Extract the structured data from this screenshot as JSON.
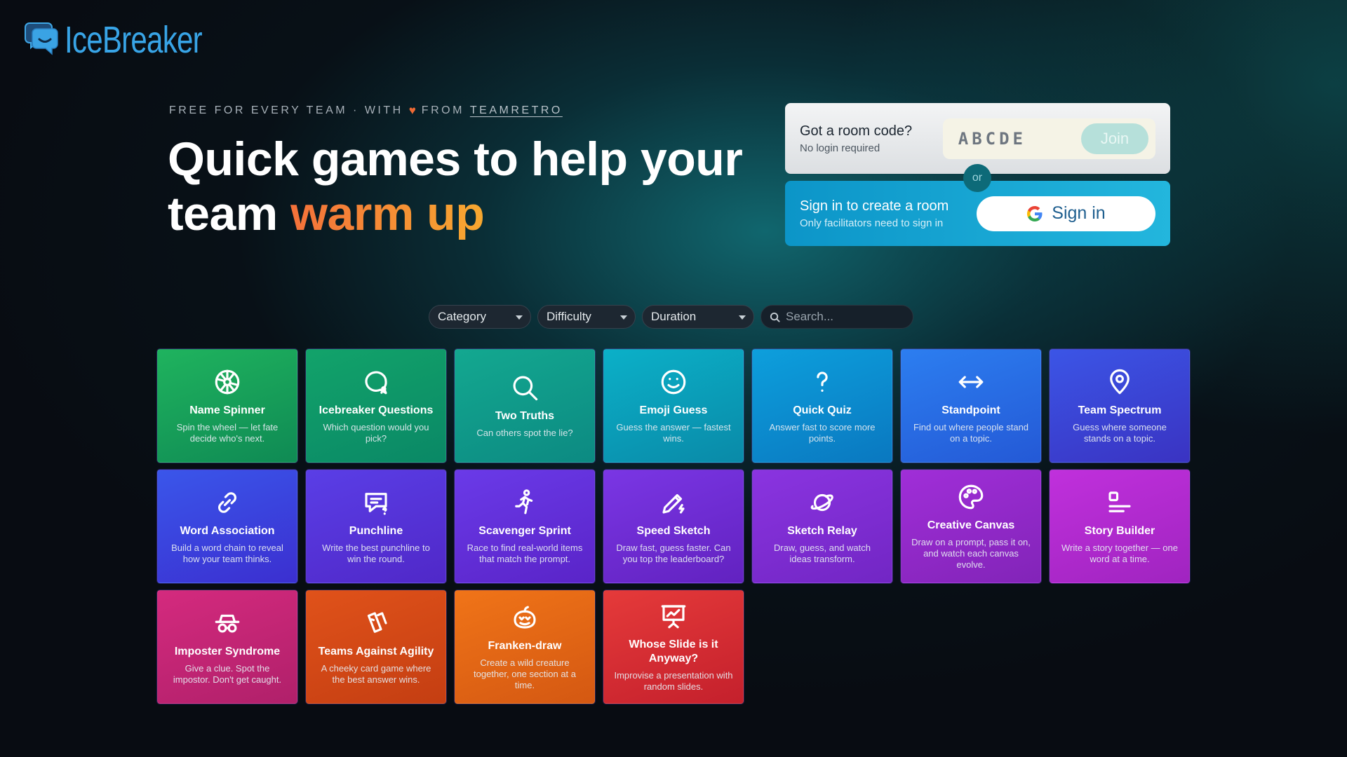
{
  "brand": {
    "name": "IceBreaker",
    "logo_icon": "chat-bubbles-icon"
  },
  "hero": {
    "eyebrow_prefix": "FREE FOR EVERY TEAM · WITH",
    "eyebrow_heart": "♥",
    "eyebrow_from": "FROM",
    "eyebrow_link": "TEAMRETRO",
    "headline_line1": "Quick games to help your",
    "headline_line2_plain": "team",
    "headline_line2_accent": "warm up"
  },
  "room": {
    "title": "Got a room code?",
    "subtitle": "No login required",
    "code_placeholder": "ABCDE",
    "join_label": "Join"
  },
  "or_label": "or",
  "signin": {
    "title": "Sign in to create a room",
    "subtitle": "Only facilitators need to sign in",
    "button_label": "Sign in"
  },
  "filters": {
    "category": "Category",
    "difficulty": "Difficulty",
    "duration": "Duration",
    "search_placeholder": "Search..."
  },
  "games": [
    {
      "title": "Name Spinner",
      "desc": "Spin the wheel — let fate decide who's next.",
      "icon": "wheel-icon",
      "color_from": "#1fb35e",
      "color_to": "#0f8a54"
    },
    {
      "title": "Icebreaker Questions",
      "desc": "Which question would you pick?",
      "icon": "question-bubble-icon",
      "color_from": "#12a36a",
      "color_to": "#0a8866"
    },
    {
      "title": "Two Truths",
      "desc": "Can others spot the lie?",
      "icon": "magnifier-icon",
      "color_from": "#13a890",
      "color_to": "#0c8a82"
    },
    {
      "title": "Emoji Guess",
      "desc": "Guess the answer — fastest wins.",
      "icon": "smiley-icon",
      "color_from": "#0bb0c8",
      "color_to": "#0a8aa8"
    },
    {
      "title": "Quick Quiz",
      "desc": "Answer fast to score more points.",
      "icon": "question-mark-icon",
      "color_from": "#0d9fdc",
      "color_to": "#0a78c0"
    },
    {
      "title": "Standpoint",
      "desc": "Find out where people stand on a topic.",
      "icon": "arrows-horizontal-icon",
      "color_from": "#2c7ef0",
      "color_to": "#2459d6"
    },
    {
      "title": "Team Spectrum",
      "desc": "Guess where someone stands on a topic.",
      "icon": "map-pin-icon",
      "color_from": "#3b55e6",
      "color_to": "#3a33c2"
    },
    {
      "title": "Word Association",
      "desc": "Build a word chain to reveal how your team thinks.",
      "icon": "link-icon",
      "color_from": "#3a56ea",
      "color_to": "#3b2fd0"
    },
    {
      "title": "Punchline",
      "desc": "Write the best punchline to win the round.",
      "icon": "message-question-icon",
      "color_from": "#5a3ee6",
      "color_to": "#5028c8"
    },
    {
      "title": "Scavenger Sprint",
      "desc": "Race to find real-world items that match the prompt.",
      "icon": "running-person-icon",
      "color_from": "#6a3ae8",
      "color_to": "#5a24c8"
    },
    {
      "title": "Speed Sketch",
      "desc": "Draw fast, guess faster. Can you top the leaderboard?",
      "icon": "pencil-bolt-icon",
      "color_from": "#7a36e4",
      "color_to": "#6222c0"
    },
    {
      "title": "Sketch Relay",
      "desc": "Draw, guess, and watch ideas transform.",
      "icon": "planet-icon",
      "color_from": "#8a34e0",
      "color_to": "#7226c4"
    },
    {
      "title": "Creative Canvas",
      "desc": "Draw on a prompt, pass it on, and watch each canvas evolve.",
      "icon": "palette-icon",
      "color_from": "#a02ed8",
      "color_to": "#8224b8"
    },
    {
      "title": "Story Builder",
      "desc": "Write a story together — one word at a time.",
      "icon": "text-lines-icon",
      "color_from": "#c030dc",
      "color_to": "#a024c0"
    },
    {
      "title": "Imposter Syndrome",
      "desc": "Give a clue. Spot the impostor. Don't get caught.",
      "icon": "spy-icon",
      "color_from": "#d42a7e",
      "color_to": "#b0206a"
    },
    {
      "title": "Teams Against Agility",
      "desc": "A cheeky card game where the best answer wins.",
      "icon": "cards-icon",
      "color_from": "#e0521a",
      "color_to": "#c43e12"
    },
    {
      "title": "Franken-draw",
      "desc": "Create a wild creature together, one section at a time.",
      "icon": "pumpkin-icon",
      "color_from": "#f07418",
      "color_to": "#d45812"
    },
    {
      "title": "Whose Slide is it Anyway?",
      "desc": "Improvise a presentation with random slides.",
      "icon": "presentation-icon",
      "color_from": "#e53a3a",
      "color_to": "#c4202c"
    }
  ]
}
